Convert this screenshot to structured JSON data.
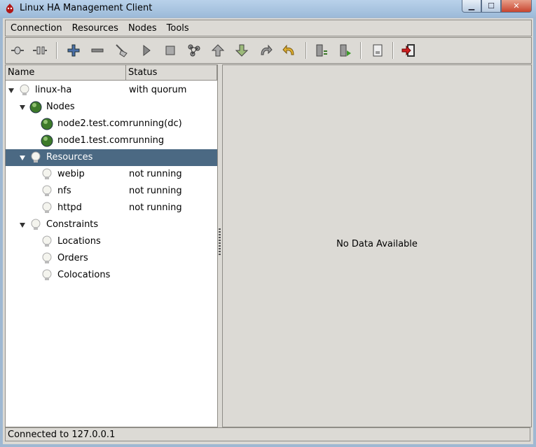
{
  "window": {
    "title": "Linux HA Management Client",
    "minimize": "▁",
    "maximize": "☐",
    "close": "✕"
  },
  "menubar": [
    "Connection",
    "Resources",
    "Nodes",
    "Tools"
  ],
  "toolbar": [
    "connect-icon",
    "disconnect-icon",
    "add-icon",
    "remove-icon",
    "cleanup-icon",
    "start-icon",
    "stop-icon",
    "migrate-icon",
    "move-up-icon",
    "move-down-icon",
    "redo-icon",
    "undo-icon",
    "standby-icon",
    "active-icon",
    "view-icon",
    "exit-icon"
  ],
  "tree": {
    "headers": {
      "name": "Name",
      "status": "Status"
    },
    "rows": [
      {
        "label": "linux-ha",
        "status": "with quorum"
      },
      {
        "label": "Nodes",
        "status": ""
      },
      {
        "label": "node2.test.com",
        "status": "running(dc)"
      },
      {
        "label": "node1.test.com",
        "status": "running"
      },
      {
        "label": "Resources",
        "status": ""
      },
      {
        "label": "webip",
        "status": "not running"
      },
      {
        "label": "nfs",
        "status": "not running"
      },
      {
        "label": "httpd",
        "status": "not running"
      },
      {
        "label": "Constraints",
        "status": ""
      },
      {
        "label": "Locations",
        "status": ""
      },
      {
        "label": "Orders",
        "status": ""
      },
      {
        "label": "Colocations",
        "status": ""
      }
    ]
  },
  "detail": {
    "message": "No Data Available"
  },
  "statusbar": {
    "text": "Connected to 127.0.0.1"
  },
  "colors": {
    "selection": "#4b6983",
    "node": "#3d7a2a"
  }
}
